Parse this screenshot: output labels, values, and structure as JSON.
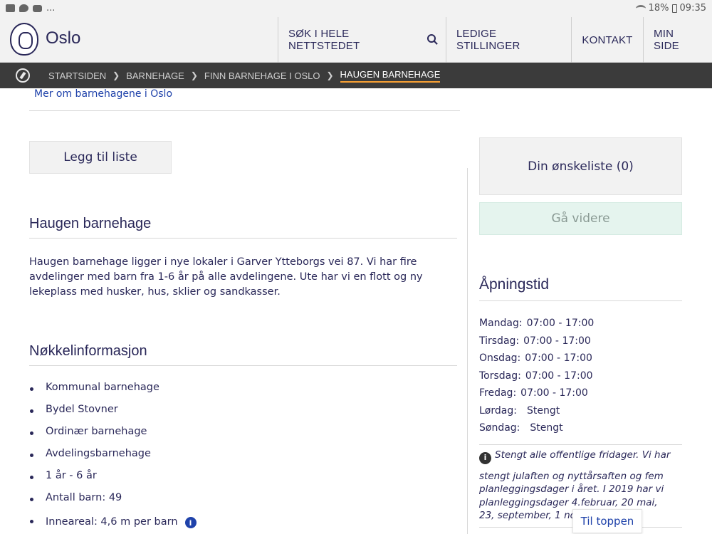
{
  "status_bar": {
    "left_more": "...",
    "battery": "18%",
    "time": "09:35"
  },
  "header": {
    "brand": "Oslo",
    "nav": [
      {
        "label": "SØK I HELE NETTSTEDET"
      },
      {
        "label": "LEDIGE STILLINGER"
      },
      {
        "label": "KONTAKT"
      },
      {
        "label": "MIN SIDE"
      }
    ]
  },
  "breadcrumb": {
    "items": [
      "STARTSIDEN",
      "BARNEHAGE",
      "FINN BARNEHAGE I OSLO"
    ],
    "current": "HAUGEN BARNEHAGE"
  },
  "main": {
    "more_link": "Mer om barnehagene i Oslo",
    "add_button": "Legg til liste",
    "title": "Haugen barnehage",
    "description": "Haugen barnehage ligger i nye lokaler i Garver Ytteborgs vei 87. Vi har fire avdelinger med barn fra 1-6 år på alle avdelingene. Ute har vi en flott og ny lekeplass med husker, hus, sklier og sandkasser.",
    "key_title": "Nøkkelinformasjon",
    "key_facts": [
      "Kommunal barnehage",
      "Bydel Stovner",
      "Ordinær barnehage",
      "Avdelingsbarnehage",
      "1 år - 6 år",
      "Antall barn: 49",
      "Inneareal: 4,6 m per barn"
    ]
  },
  "sidebar": {
    "wishlist": "Din ønskeliste (0)",
    "continue": "Gå videre",
    "opening_title": "Åpningstid",
    "hours": [
      {
        "day": "Mandag:",
        "time": "07:00 - 17:00"
      },
      {
        "day": "Tirsdag:",
        "time": "07:00 - 17:00"
      },
      {
        "day": "Onsdag:",
        "time": "07:00 - 17:00"
      },
      {
        "day": "Torsdag:",
        "time": "07:00 - 17:00"
      },
      {
        "day": "Fredag:",
        "time": "07:00 - 17:00"
      },
      {
        "day": "Lørdag:",
        "time": "Stengt"
      },
      {
        "day": "Søndag:",
        "time": "Stengt"
      }
    ],
    "note_1": "Stengt alle offentlige fridager. Vi har",
    "note_2": "stengt julaften og nyttårsaften og fem planleggingsdager i året. I 2019 har vi planleggingsdager 4.februar, 20 mai, 23, september, 1 novem..."
  },
  "to_top": "Til toppen",
  "colors": {
    "primary": "#2a2859",
    "link": "#1f42aa",
    "accent": "#f9a134",
    "breadcrumb_bg": "#3b3b3b",
    "continue_bg": "#e5f4ee"
  }
}
